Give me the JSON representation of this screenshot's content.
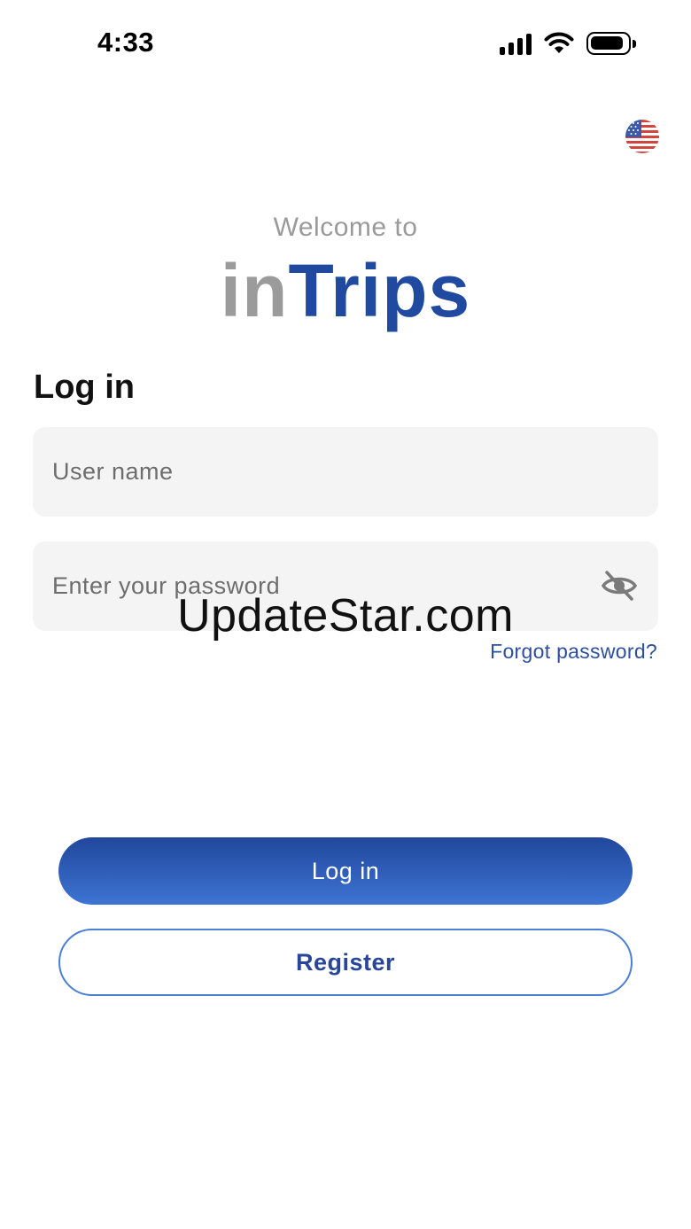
{
  "status_bar": {
    "time": "4:33",
    "icons": [
      "signal-icon",
      "wifi-icon",
      "battery-icon"
    ]
  },
  "header": {
    "language_flag": "us-flag-icon"
  },
  "welcome": {
    "text": "Welcome to",
    "logo_prefix": "in",
    "logo_suffix": "Trips"
  },
  "login": {
    "heading": "Log in",
    "username_placeholder": "User name",
    "password_placeholder": "Enter your password",
    "password_toggle_icon": "eye-slash-icon",
    "forgot_password": "Forgot password?",
    "login_button": "Log in",
    "register_button": "Register"
  },
  "watermark": "UpdateStar.com",
  "colors": {
    "brand_blue": "#1f4aa0",
    "logo_gray": "#9b9b9b",
    "field_bg": "#f4f4f4",
    "button_gradient_top": "#20479c",
    "button_gradient_bottom": "#3e74d3",
    "register_border": "#4a7fd4"
  }
}
